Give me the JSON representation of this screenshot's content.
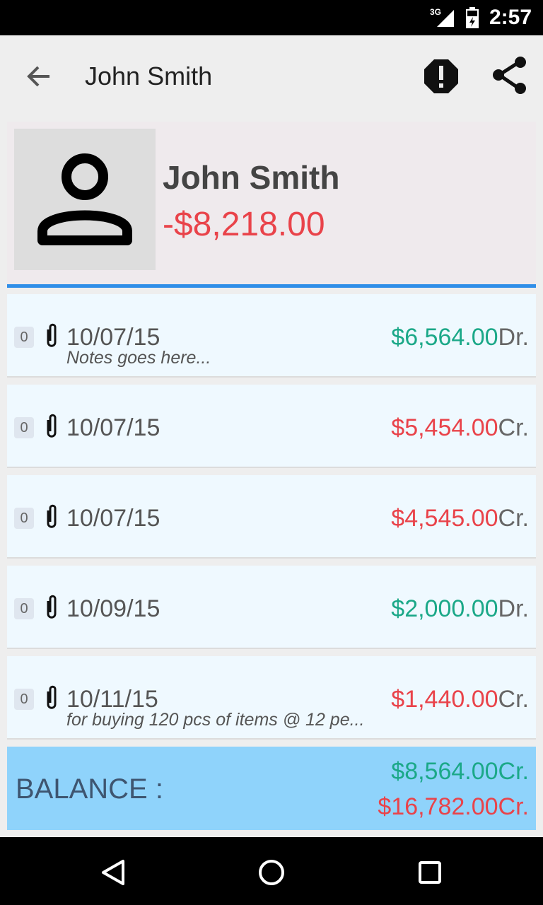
{
  "status": {
    "network": "3G",
    "time": "2:57"
  },
  "appbar": {
    "title": "John Smith",
    "back_icon": "arrow-back-icon",
    "alert_icon": "alert-octagon-icon",
    "share_icon": "share-icon"
  },
  "profile": {
    "name": "John Smith",
    "balance": "-$8,218.00",
    "avatar_icon": "person-icon"
  },
  "entries": [
    {
      "count": "0",
      "date": "10/07/15",
      "note": "Notes goes here...",
      "amount": "$6,564.00",
      "type": "Dr."
    },
    {
      "count": "0",
      "date": "10/07/15",
      "note": "",
      "amount": "$5,454.00",
      "type": "Cr."
    },
    {
      "count": "0",
      "date": "10/07/15",
      "note": "",
      "amount": "$4,545.00",
      "type": "Cr."
    },
    {
      "count": "0",
      "date": "10/09/15",
      "note": "",
      "amount": "$2,000.00",
      "type": "Dr."
    },
    {
      "count": "0",
      "date": "10/11/15",
      "note": "for buying 120 pcs of items @ 12 pe...",
      "amount": "$1,440.00",
      "type": "Cr."
    }
  ],
  "balance": {
    "label": "BALANCE :",
    "dr_amount": "$8,564.00",
    "dr_unit": "Cr.",
    "cr_amount": "$16,782.00",
    "cr_unit": "Cr."
  },
  "colors": {
    "debit": "#1ba888",
    "credit": "#e9434a",
    "accent": "#2f8ee8",
    "balance_bg": "#8fd3fb"
  }
}
